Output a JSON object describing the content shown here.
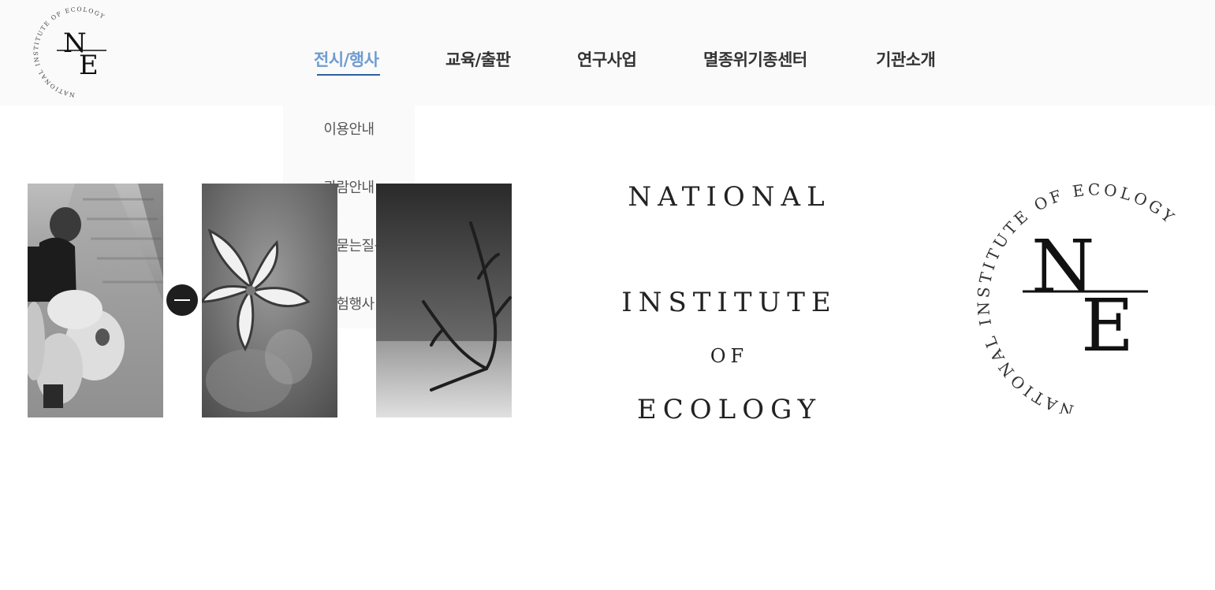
{
  "header": {
    "logo": {
      "ring_text": "NATIONAL INSTITUTE OF ECOLOGY",
      "monogram_top": "N",
      "monogram_bottom": "E"
    },
    "nav": [
      {
        "label": "전시/행사",
        "active": true
      },
      {
        "label": "교육/출판",
        "active": false
      },
      {
        "label": "연구사업",
        "active": false
      },
      {
        "label": "멸종위기종센터",
        "active": false
      },
      {
        "label": "기관소개",
        "active": false
      }
    ],
    "dropdown": [
      "이용안내",
      "관람안내",
      "자주묻는질문",
      "체험행사"
    ]
  },
  "hero": {
    "photos": [
      {
        "icon": "child-with-teddy-bear-photo"
      },
      {
        "icon": "flower-photo"
      },
      {
        "icon": "dead-tree-branch-photo"
      }
    ],
    "toggle_icon": "minus-icon",
    "title_lines": [
      "NATIONAL",
      "INSTITUTE",
      "OF",
      "ECOLOGY"
    ],
    "logo": {
      "ring_text": "NATIONAL INSTITUTE OF ECOLOGY",
      "monogram_top": "N",
      "monogram_bottom": "E"
    }
  },
  "colors": {
    "header_bg": "#fafafa",
    "active_nav": "#6f9ccf",
    "underline": "#2f5fa0",
    "text": "#333333"
  }
}
